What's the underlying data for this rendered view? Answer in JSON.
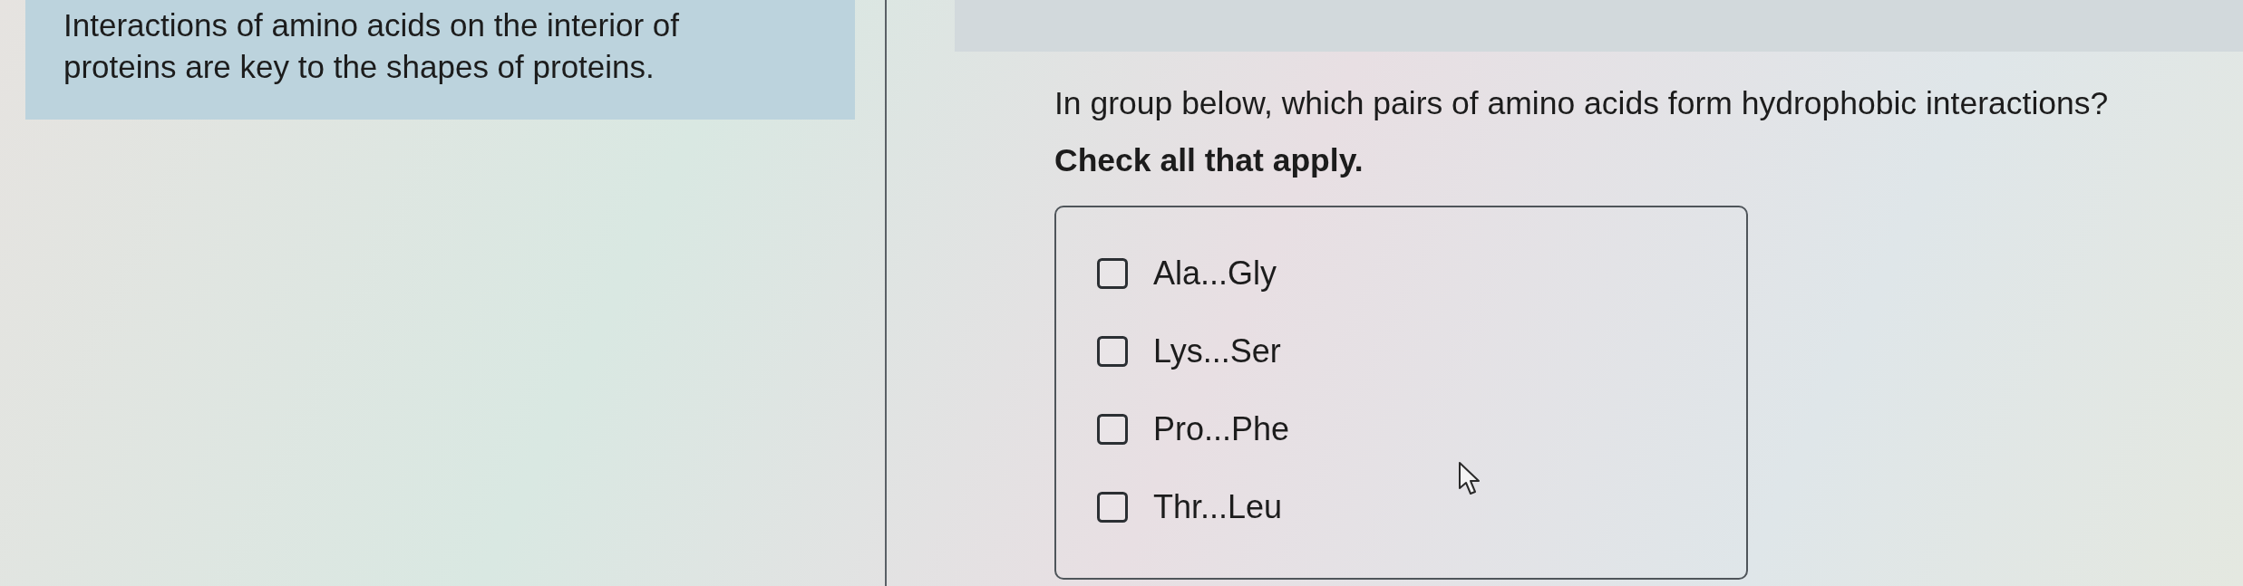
{
  "intro_panel": {
    "text": "Interactions of amino acids on the interior of proteins are key to the shapes of proteins."
  },
  "question": {
    "prompt": "In group below, which pairs of amino acids form hydrophobic interactions?",
    "instruction": "Check all that apply.",
    "options": [
      {
        "label": "Ala...Gly",
        "checked": false
      },
      {
        "label": "Lys...Ser",
        "checked": false
      },
      {
        "label": "Pro...Phe",
        "checked": false
      },
      {
        "label": "Thr...Leu",
        "checked": false
      }
    ]
  }
}
